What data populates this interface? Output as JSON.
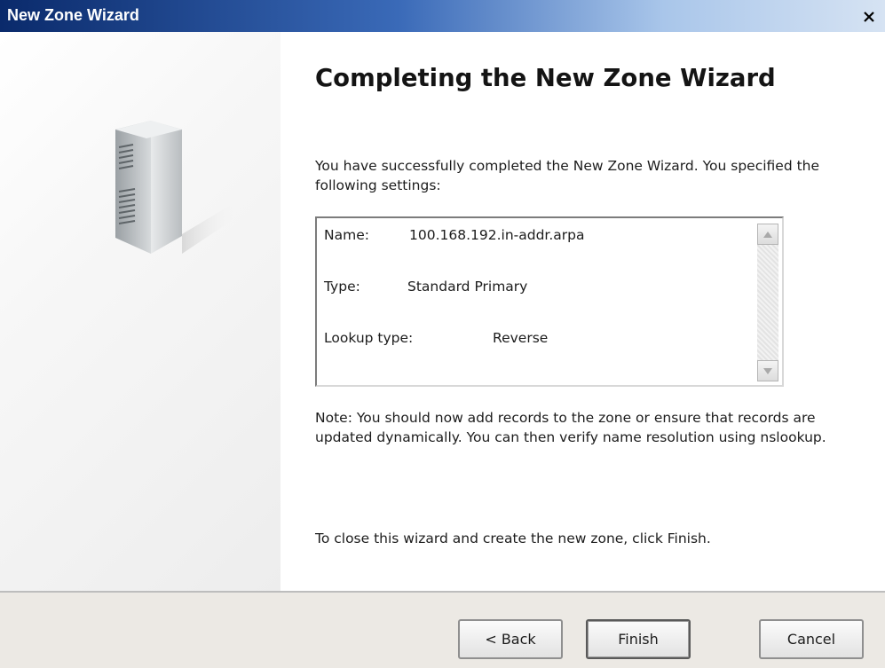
{
  "window": {
    "title": "New Zone Wizard",
    "close_icon": "close-icon"
  },
  "sidebar": {
    "image": "server-tower-icon"
  },
  "main": {
    "heading": "Completing the New Zone Wizard",
    "intro_text": "You have successfully completed the New Zone Wizard. You specified the following settings:",
    "summary": {
      "name_label": "Name:",
      "name_value": "100.168.192.in-addr.arpa",
      "type_label": "Type:",
      "type_value": "Standard Primary",
      "lookup_label": "Lookup type:",
      "lookup_value": "Reverse"
    },
    "note_text": "Note: You should now add records to the zone or ensure that records are updated dynamically. You can then verify name resolution using nslookup.",
    "close_text": "To close this wizard and create the new zone, click Finish."
  },
  "buttons": {
    "back": "< Back",
    "finish": "Finish",
    "cancel": "Cancel"
  },
  "colors": {
    "titlebar_start": "#0a2a6b",
    "titlebar_end": "#d6e3f3",
    "footer_bg": "#ece9e4"
  }
}
